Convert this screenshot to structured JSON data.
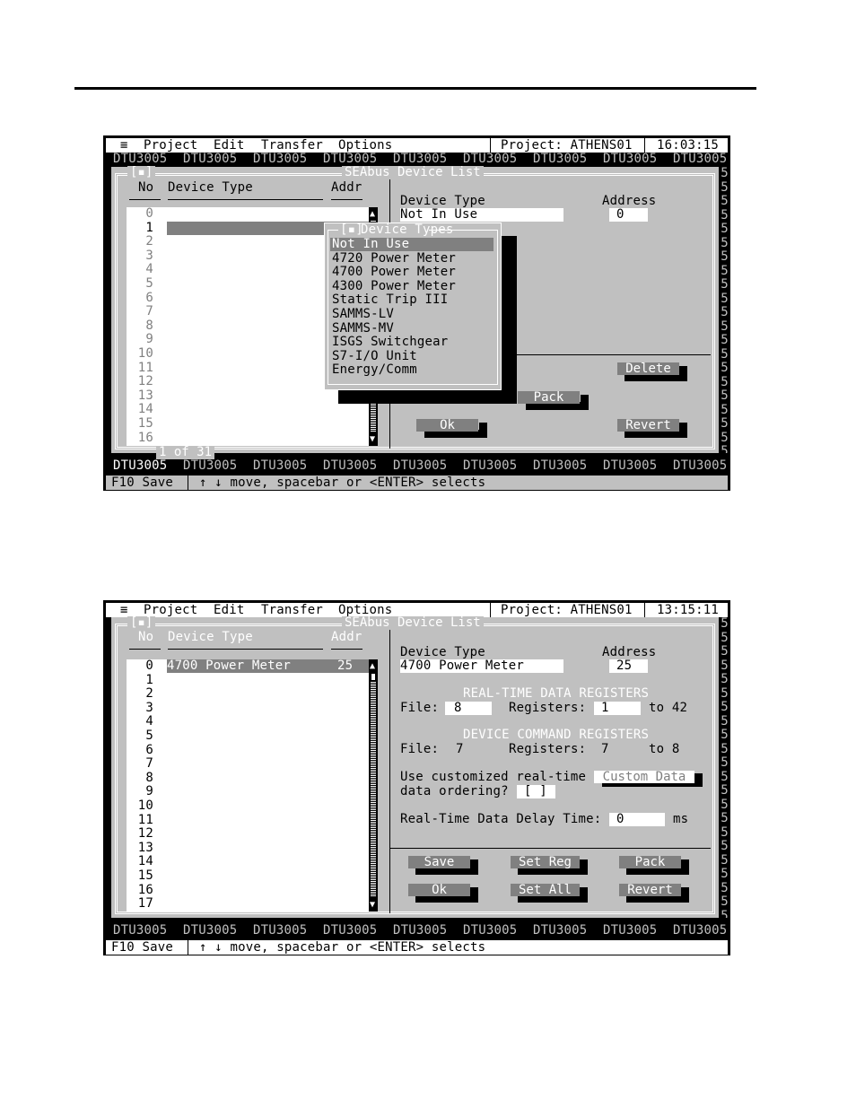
{
  "screens": [
    {
      "menu": {
        "system_icon": "≡",
        "items": [
          "Project",
          "Edit",
          "Transfer",
          "Options"
        ],
        "project_label": "Project: ATHENS01",
        "time": "16:03:15"
      },
      "banner_text": "DTU3005",
      "window": {
        "close_box": "[▪]",
        "title": "SEAbus Device List",
        "columns": {
          "no": "No",
          "type": "Device Type",
          "addr": "Addr"
        },
        "rows": [
          "0",
          "1",
          "2",
          "3",
          "4",
          "5",
          "6",
          "7",
          "8",
          "9",
          "10",
          "11",
          "12",
          "13",
          "14",
          "15",
          "16"
        ],
        "selected_row": 1,
        "selected_row_type": "",
        "selected_row_addr": "",
        "pager": "1 of 31",
        "device_type_label": "Device Type",
        "device_type_value": "Not In Use",
        "address_label": "Address",
        "address_value": "0",
        "buttons": {
          "delete": "Delete",
          "pack": "Pack",
          "ok": "Ok",
          "revert": "Revert"
        }
      },
      "popup": {
        "close_box": "[▪]",
        "title": "Device Types",
        "options": [
          "Not In Use",
          "4720 Power Meter",
          "4700 Power Meter",
          "4300 Power Meter",
          "Static Trip III",
          "SAMMS-LV",
          "SAMMS-MV",
          "ISGS Switchgear",
          "S7-I/O Unit",
          "Energy/Comm"
        ],
        "selected": "Not In Use"
      },
      "status": {
        "save_key": "F10 Save",
        "hint": "↑ ↓ move, spacebar or <ENTER> selects"
      }
    },
    {
      "menu": {
        "system_icon": "≡",
        "items": [
          "Project",
          "Edit",
          "Transfer",
          "Options"
        ],
        "project_label": "Project: ATHENS01",
        "time": "13:15:11"
      },
      "banner_text": "DTU3005",
      "window": {
        "close_box": "[▪]",
        "title": "SEAbus Device List",
        "columns": {
          "no": "No",
          "type": "Device Type",
          "addr": "Addr"
        },
        "rows": [
          "0",
          "1",
          "2",
          "3",
          "4",
          "5",
          "6",
          "7",
          "8",
          "9",
          "10",
          "11",
          "12",
          "13",
          "14",
          "15",
          "16",
          "17"
        ],
        "selected_row": 0,
        "selected_row_type": "4700 Power Meter",
        "selected_row_addr": "25",
        "device_type_label": "Device Type",
        "device_type_value": "4700 Power Meter",
        "address_label": "Address",
        "address_value": "25",
        "rt_section": "REAL-TIME DATA REGISTERS",
        "rt_file_label": "File:",
        "rt_file_value": "8",
        "rt_reg_label": "Registers:",
        "rt_reg_from": "1",
        "rt_reg_to": "to 42",
        "cmd_section": "DEVICE COMMAND REGISTERS",
        "cmd_file_label": "File:",
        "cmd_file_value": "7",
        "cmd_reg_label": "Registers:",
        "cmd_reg_from": "7",
        "cmd_reg_to": "to 8",
        "custom_q_line1": "Use customized real-time",
        "custom_q_line2": "data ordering?",
        "custom_checkbox": "[ ]",
        "custom_data_button": "Custom Data",
        "delay_label": "Real-Time Data Delay Time:",
        "delay_value": "0",
        "delay_unit": "ms",
        "buttons": {
          "save": "Save",
          "set_reg": "Set Reg",
          "pack": "Pack",
          "ok": "Ok",
          "set_all": "Set All",
          "revert": "Revert"
        }
      },
      "status": {
        "save_key": "F10 Save",
        "hint": "↑ ↓ move, spacebar or <ENTER> selects"
      }
    }
  ]
}
